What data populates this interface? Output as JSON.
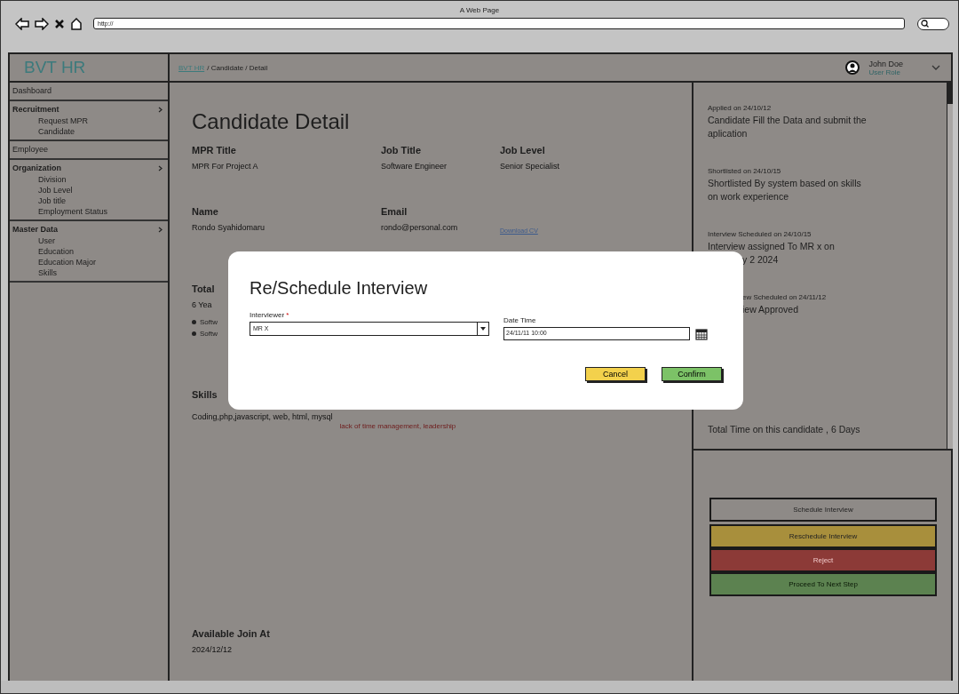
{
  "browser": {
    "title": "A Web Page",
    "url": "http://"
  },
  "app": {
    "brand": "BVT HR",
    "breadcrumb": [
      {
        "label": "BVT HR",
        "kind": "link"
      },
      {
        "label": "/ Candidate / Detail",
        "kind": "text"
      }
    ],
    "user": {
      "name": "John Doe",
      "role": "User Role"
    }
  },
  "sidebar": {
    "items": [
      {
        "label": "Dashboard"
      },
      {
        "label": "Recruitment",
        "children": [
          {
            "label": "Request MPR"
          },
          {
            "label": "Candidate"
          }
        ]
      },
      {
        "label": "Employee"
      },
      {
        "label": "Organization",
        "children": [
          {
            "label": "Division"
          },
          {
            "label": "Job Level"
          },
          {
            "label": "Job title"
          },
          {
            "label": "Employment Status"
          }
        ]
      },
      {
        "label": "Master Data",
        "children": [
          {
            "label": "User"
          },
          {
            "label": "Education"
          },
          {
            "label": "Education Major"
          },
          {
            "label": "Skills"
          }
        ]
      }
    ]
  },
  "main": {
    "title": "Candidate Detail",
    "rows": [
      {
        "cells": [
          {
            "label": "MPR Title",
            "value": "MPR For Project A"
          },
          {
            "label": "Job Title",
            "value": "Software Engineer"
          },
          {
            "label": "Job Level",
            "value": "Senior Specialist"
          }
        ]
      },
      {
        "cells": [
          {
            "label": "Name",
            "value": "Rondo Syahidomaru"
          },
          {
            "label": "Email",
            "value": "rondo@personal.com"
          },
          {
            "link": "Download CV"
          }
        ]
      }
    ],
    "experience": {
      "label": "Total",
      "value": "6 Yea",
      "bullets": [
        "Softw",
        "Softw"
      ]
    },
    "skills": {
      "label": "Skills",
      "value": "Coding,php,javascript, web, html, mysql",
      "note": "lack of time management, leadership"
    },
    "available": {
      "label": "Available Join At",
      "value": "2024/12/12"
    }
  },
  "timeline": {
    "events": [
      {
        "lines": [
          {
            "kind": "heading",
            "text": "Applied on 24/10/12",
            "covered": false
          },
          {
            "kind": "body",
            "text": "Candidate Fill the Data and submit the aplication",
            "covered": false
          }
        ]
      },
      {
        "lines": [
          {
            "kind": "heading",
            "text": "Shortlisted on 24/10/15",
            "covered": false
          },
          {
            "kind": "body",
            "text": "Shortlisted By system based on skills on work experience",
            "covered": false
          }
        ]
      },
      {
        "lines": [
          {
            "kind": "heading",
            "text": "Interview Scheduled on 24/10/15",
            "covered": false
          },
          {
            "kind": "body",
            "text": "Interview assigned To MR x on",
            "covered": false
          },
          {
            "kind": "body",
            "text": "y 2 2024",
            "covered": true
          }
        ]
      },
      {
        "lines": [
          {
            "kind": "heading",
            "text": "ew Scheduled on 24/11/12",
            "covered": true
          },
          {
            "kind": "body",
            "text": "iew Approved",
            "covered": true
          }
        ]
      }
    ],
    "total": "Total Time on this candidate , 6 Days"
  },
  "actions": [
    {
      "label": "Schedule Interview",
      "kind": "neutral"
    },
    {
      "label": "Reschedule Interview",
      "kind": "warning"
    },
    {
      "label": "Reject",
      "kind": "danger"
    },
    {
      "label": "Proceed To Next Step",
      "kind": "success"
    }
  ],
  "dialog": {
    "title": "Re/Schedule Interview",
    "interviewer": {
      "label": "Interviewer",
      "required_mark": "*",
      "value": "MR X"
    },
    "datetime": {
      "label": "Date Time",
      "value": "24/11/11 10:00"
    },
    "buttons": [
      {
        "label": "Cancel",
        "kind": "cancel"
      },
      {
        "label": "Confirm",
        "kind": "confirm"
      }
    ]
  }
}
